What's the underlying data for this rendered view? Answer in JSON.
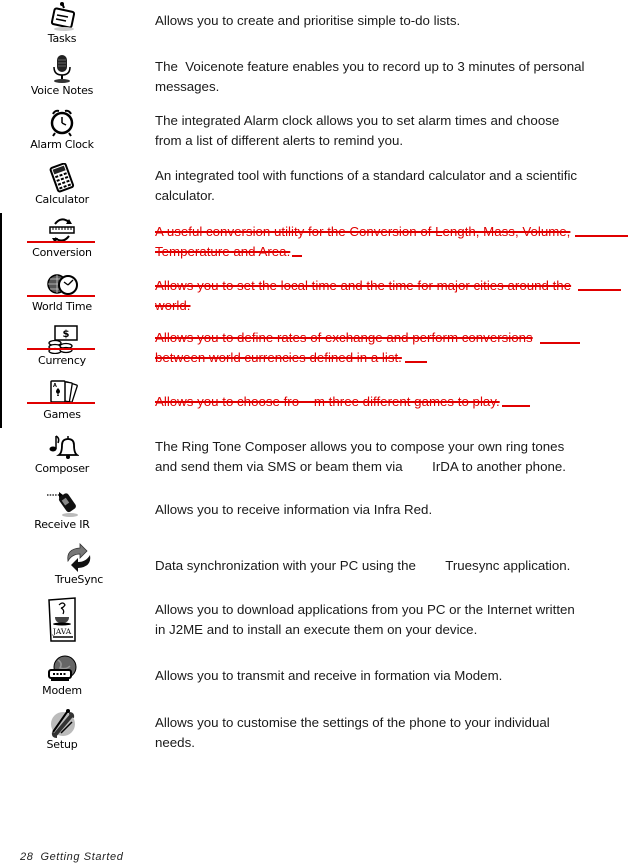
{
  "page": {
    "footer": {
      "page_number": "28",
      "section": "Getting Started"
    }
  },
  "colors": {
    "text": "#1a1a1a",
    "deleted": "#e00000",
    "change_bar": "#000000"
  },
  "entries": [
    {
      "icon": "tasks-icon",
      "label": "Tasks",
      "deleted": false,
      "lines": [
        "Allows you to create and prioritise simple to-do lists."
      ]
    },
    {
      "icon": "voice-notes-icon",
      "label": "Voice Notes",
      "deleted": false,
      "lines": [
        "The  Voicenote feature enables you to record up to 3 minutes of personal",
        "messages."
      ]
    },
    {
      "icon": "alarm-clock-icon",
      "label": "Alarm Clock",
      "deleted": false,
      "lines": [
        "The integrated Alarm clock allows you to set alarm times and choose",
        "from a list of different alerts to remind you."
      ]
    },
    {
      "icon": "calculator-icon",
      "label": "Calculator",
      "deleted": false,
      "lines": [
        "An integrated tool with functions of a standard calculator and a scientific",
        "calculator."
      ]
    },
    {
      "icon": "conversion-icon",
      "label": "Conversion",
      "deleted": true,
      "lines": [
        "A useful conversion utility for the Conversion of Length, Mass, Volume,",
        "Temperature and Area."
      ]
    },
    {
      "icon": "world-time-icon",
      "label": "World Time",
      "deleted": true,
      "lines": [
        "Allows you to set the local time and the time for major cities around the",
        "world."
      ]
    },
    {
      "icon": "currency-icon",
      "label": "Currency",
      "deleted": true,
      "lines": [
        "Allows you to define rates of exchange and perform conversions",
        "between world currencies defined in a list."
      ]
    },
    {
      "icon": "games-icon",
      "label": "Games",
      "deleted": true,
      "lines": [
        "Allows you to choose fro    m three different games to play."
      ]
    },
    {
      "icon": "composer-icon",
      "label": "Composer",
      "deleted": false,
      "lines": [
        "The Ring Tone Composer allows you to compose your own ring tones",
        "and send them via SMS or beam them via        IrDA to another phone."
      ]
    },
    {
      "icon": "receive-ir-icon",
      "label": "Receive IR",
      "deleted": false,
      "lines": [
        "Allows you to receive information via Infra Red."
      ]
    },
    {
      "icon": "truesync-icon",
      "label": "TrueSync",
      "deleted": false,
      "lines": [
        "Data synchronization with your PC using the        Truesync application."
      ]
    },
    {
      "icon": "java-icon",
      "label": "",
      "deleted": false,
      "lines": [
        "Allows you to download applications from you PC or the Internet written",
        "in J2ME and to install an execute them on your device."
      ]
    },
    {
      "icon": "modem-icon",
      "label": "Modem",
      "deleted": false,
      "lines": [
        "Allows you to transmit and receive in formation via Modem."
      ]
    },
    {
      "icon": "setup-icon",
      "label": "Setup",
      "deleted": false,
      "lines": [
        "Allows you to customise the settings of the phone to your individual",
        "needs."
      ]
    }
  ]
}
